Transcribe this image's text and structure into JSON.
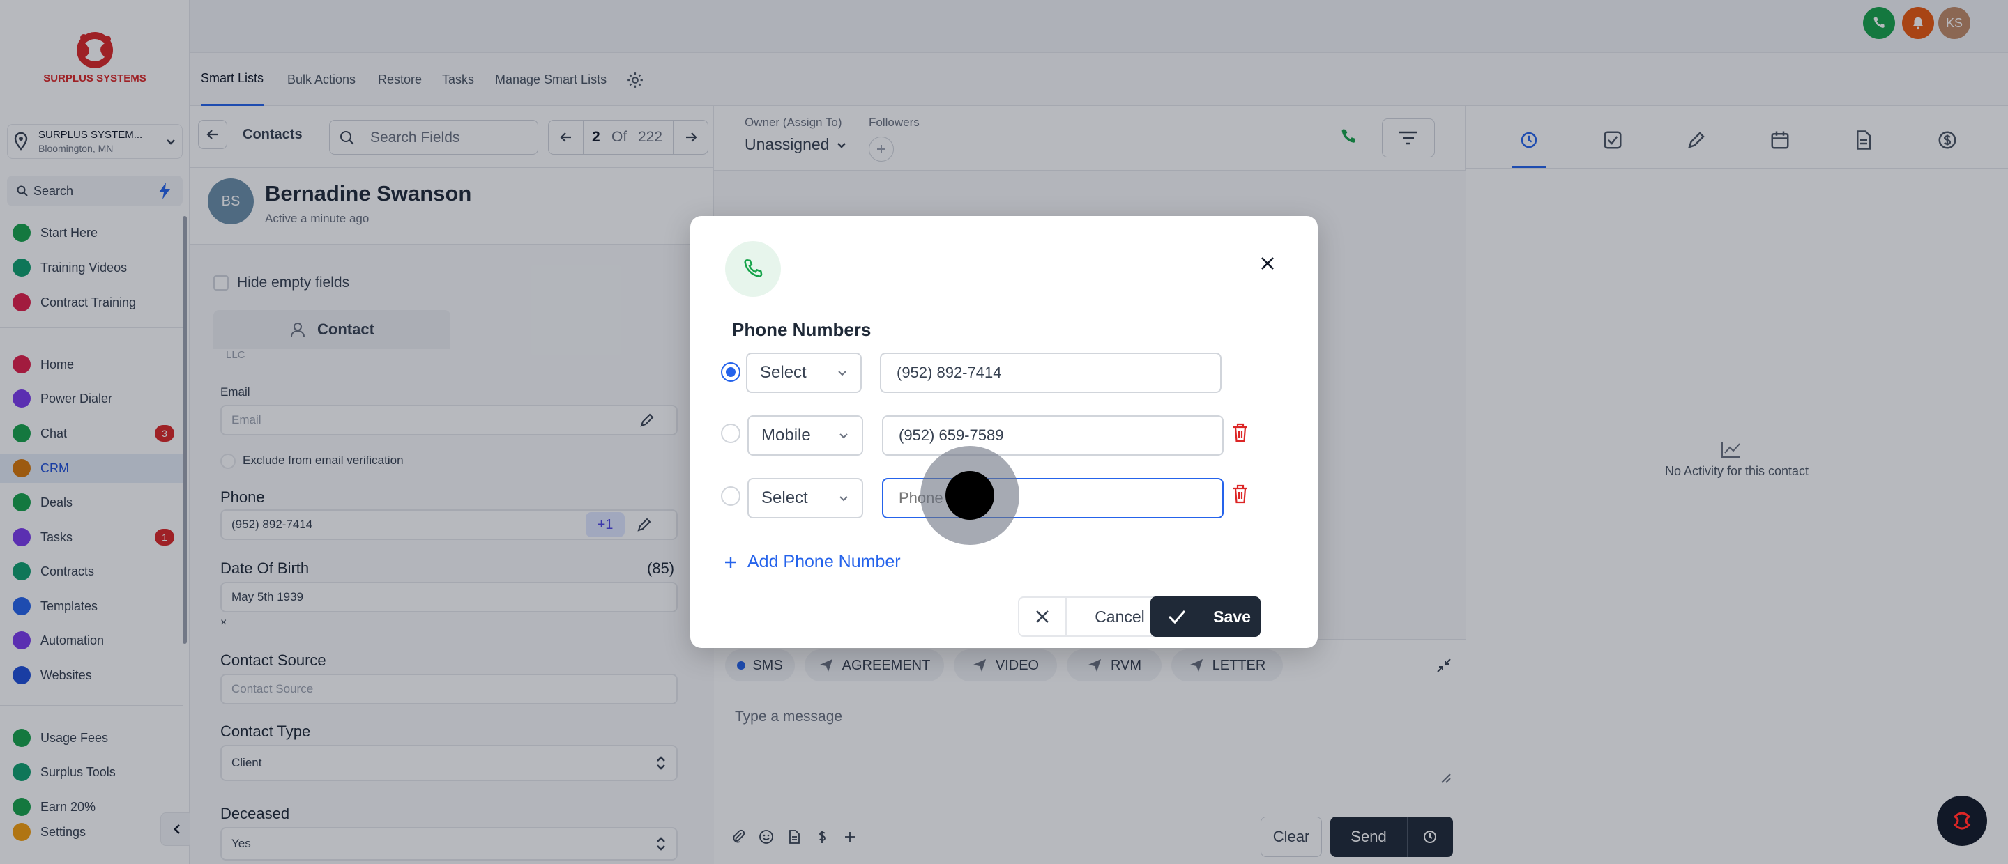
{
  "brand": {
    "name": "SURPLUS SYSTEMS",
    "color": "#dc2626"
  },
  "location": {
    "name": "SURPLUS SYSTEM...",
    "city": "Bloomington, MN"
  },
  "sidebar_search": {
    "placeholder": "Search"
  },
  "nav_group1": [
    {
      "label": "Start Here",
      "color": "#16a34a"
    },
    {
      "label": "Training Videos",
      "color": "#0e9f6e"
    },
    {
      "label": "Contract Training",
      "color": "#e11d48"
    }
  ],
  "nav_group2": [
    {
      "label": "Home",
      "color": "#e11d48"
    },
    {
      "label": "Power Dialer",
      "color": "#7c3aed"
    },
    {
      "label": "Chat",
      "color": "#16a34a",
      "badge": "3"
    },
    {
      "label": "CRM",
      "color": "#d97706"
    },
    {
      "label": "Deals",
      "color": "#16a34a"
    },
    {
      "label": "Tasks",
      "color": "#7c3aed",
      "badge": "1"
    },
    {
      "label": "Contracts",
      "color": "#0e9f6e"
    },
    {
      "label": "Templates",
      "color": "#2563eb"
    },
    {
      "label": "Automation",
      "color": "#7c3aed"
    },
    {
      "label": "Websites",
      "color": "#1d4ed8"
    }
  ],
  "nav_group3": [
    {
      "label": "Usage Fees",
      "color": "#16a34a"
    },
    {
      "label": "Surplus Tools",
      "color": "#0e9f6e"
    },
    {
      "label": "Earn 20%",
      "color": "#16a34a"
    },
    {
      "label": "Settings",
      "color": "#f59e0b"
    }
  ],
  "user": {
    "initials": "KS"
  },
  "tabs": [
    "Smart Lists",
    "Bulk Actions",
    "Restore",
    "Tasks",
    "Manage Smart Lists"
  ],
  "contact_header": {
    "section": "Contacts",
    "search_placeholder": "Search Fields",
    "index": "2",
    "of": "Of",
    "total": "222"
  },
  "contact": {
    "initials": "BS",
    "name": "Bernadine Swanson",
    "status": "Active a minute ago"
  },
  "left_panel": {
    "hide_empty": "Hide empty fields",
    "tab_contact": "Contact",
    "cut_text": "LLC",
    "email_label": "Email",
    "email_placeholder": "Email",
    "exclude_label": "Exclude from email verification",
    "phone_label": "Phone",
    "phone_value": "(952) 892-7414",
    "phone_extra": "+1",
    "dob_label": "Date Of Birth",
    "dob_age": "(85)",
    "dob_value": "May 5th 1939",
    "dob_clear": "×",
    "source_label": "Contact Source",
    "source_placeholder": "Contact Source",
    "type_label": "Contact Type",
    "type_value": "Client",
    "deceased_label": "Deceased",
    "deceased_value": "Yes"
  },
  "middle_header": {
    "owner_label": "Owner (Assign To)",
    "owner_value": "Unassigned",
    "followers_label": "Followers"
  },
  "composer": {
    "channels": [
      "SMS",
      "AGREEMENT",
      "VIDEO",
      "RVM",
      "LETTER"
    ],
    "placeholder": "Type a message",
    "clear": "Clear",
    "send": "Send"
  },
  "right_panel": {
    "empty": "No Activity for this contact"
  },
  "modal": {
    "title": "Phone Numbers",
    "rows": [
      {
        "type": "Select",
        "value": "(952) 892-7414",
        "placeholder": "",
        "selected": true
      },
      {
        "type": "Mobile",
        "value": "(952) 659-7589",
        "placeholder": "",
        "selected": false
      },
      {
        "type": "Select",
        "value": "",
        "placeholder": "Phone",
        "selected": false
      }
    ],
    "add_label": "Add Phone Number",
    "cancel": "Cancel",
    "save": "Save"
  },
  "colors": {
    "accent": "#2563eb",
    "dark": "#1f2937",
    "green": "#16a34a",
    "danger": "#dc2626"
  }
}
